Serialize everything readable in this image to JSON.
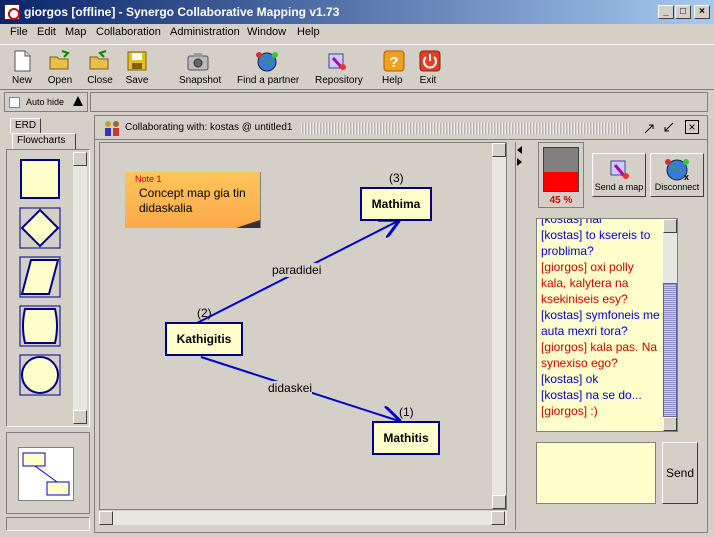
{
  "window": {
    "title": "giorgos [offline] - Synergo Collaborative Mapping v1.73"
  },
  "menu": [
    "File",
    "Edit",
    "Map",
    "Collaboration",
    "Administration",
    "Window",
    "Help"
  ],
  "toolbar": [
    {
      "label": "New",
      "icon": "new-document-icon"
    },
    {
      "label": "Open",
      "icon": "open-folder-icon"
    },
    {
      "label": "Close",
      "icon": "close-folder-icon"
    },
    {
      "label": "Save",
      "icon": "save-disk-icon"
    },
    {
      "label": "Snapshot",
      "icon": "camera-icon"
    },
    {
      "label": "Find a partner",
      "icon": "globe-people-icon"
    },
    {
      "label": "Repository",
      "icon": "repository-icon"
    },
    {
      "label": "Help",
      "icon": "help-icon"
    },
    {
      "label": "Exit",
      "icon": "power-icon"
    }
  ],
  "autohide": {
    "label": "Auto hide"
  },
  "palette": {
    "tabs": [
      "ERD",
      "Flowcharts"
    ],
    "shapes": [
      "rectangle",
      "diamond",
      "parallelogram",
      "document",
      "circle"
    ]
  },
  "collab": {
    "title": "Collaborating with: kostas @ untitled1"
  },
  "map": {
    "note": {
      "header": "Note 1",
      "text": "Concept map gia tin didaskalia"
    },
    "nodes": {
      "mathima": "Mathima",
      "kathigitis": "Kathigitis",
      "mathitis": "Mathitis"
    },
    "numbers": {
      "mathima": "(3)",
      "kathigitis": "(2)",
      "mathitis": "(1)"
    },
    "edges": {
      "paradidei": "paradidei",
      "didaskei": "didaskei"
    }
  },
  "status": {
    "percent": "45 %",
    "level": 0.45
  },
  "buttons": {
    "send_map": "Send a map",
    "disconnect": "Disconnect",
    "send": "Send"
  },
  "chat": [
    {
      "user": "kostas",
      "text": "[kostas] nai",
      "color": "#0000cc"
    },
    {
      "user": "kostas",
      "text": "[kostas] to ksereis to problima?",
      "color": "#0000cc"
    },
    {
      "user": "giorgos",
      "text": "[giorgos] oxi polly kala, kalytera na ksekiniseis esy?",
      "color": "#cc0000"
    },
    {
      "user": "kostas",
      "text": "[kostas] symfoneis me auta mexri tora?",
      "color": "#0000cc"
    },
    {
      "user": "giorgos",
      "text": "[giorgos] kala pas. Na synexiso ego?",
      "color": "#cc0000"
    },
    {
      "user": "kostas",
      "text": "[kostas] ok",
      "color": "#0000cc"
    },
    {
      "user": "kostas",
      "text": "[kostas] na se do...",
      "color": "#0000cc"
    },
    {
      "user": "giorgos",
      "text": "[giorgos] :)",
      "color": "#cc0000"
    }
  ]
}
